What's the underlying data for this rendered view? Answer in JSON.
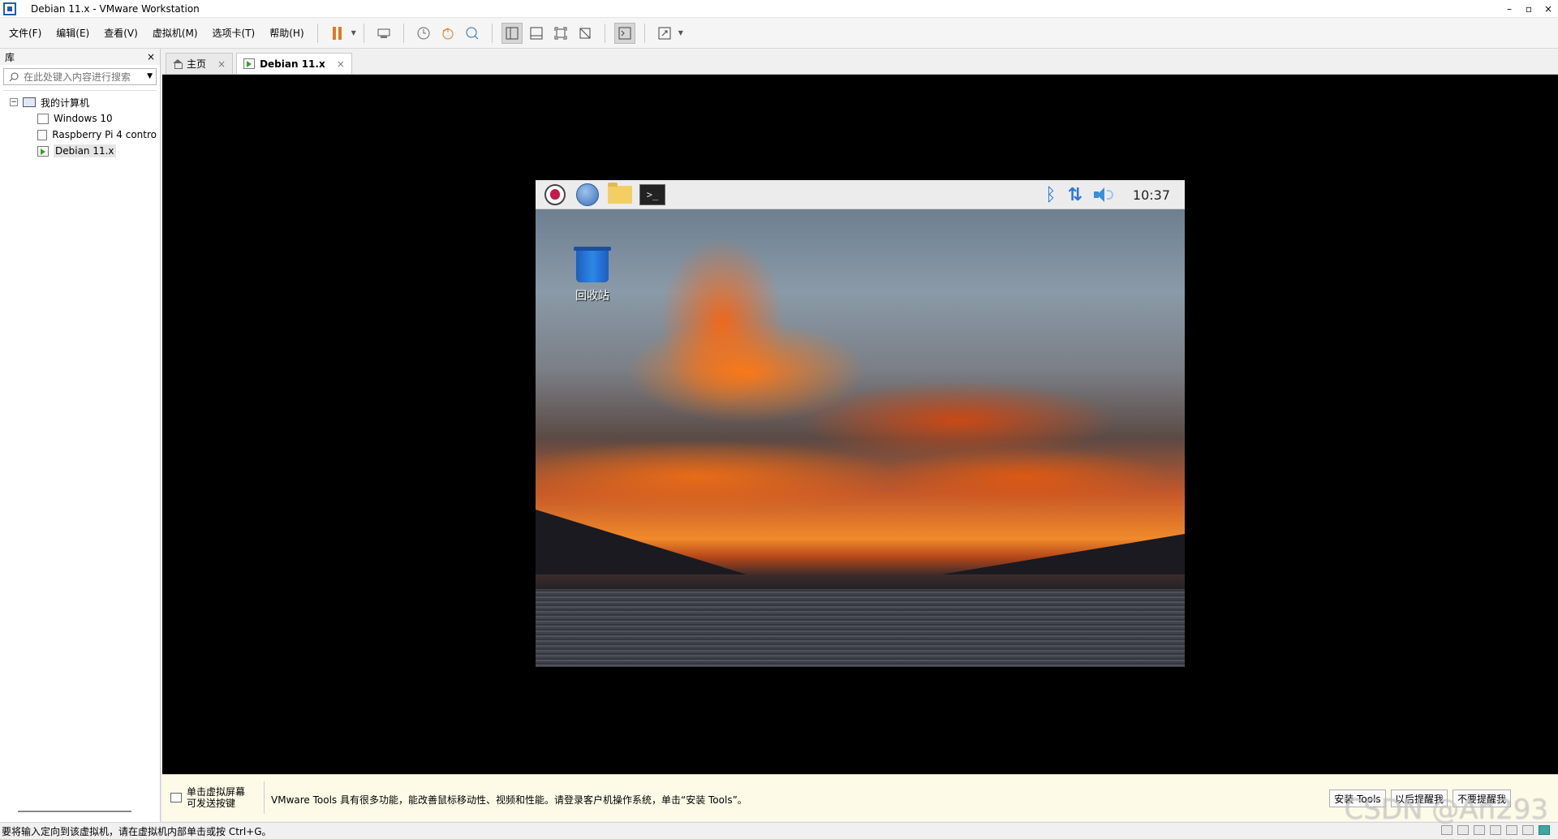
{
  "window": {
    "title": "Debian 11.x - VMware Workstation",
    "controls": [
      "–",
      "▫",
      "×"
    ]
  },
  "menu": [
    "文件(F)",
    "编辑(E)",
    "查看(V)",
    "虚拟机(M)",
    "选项卡(T)",
    "帮助(H)"
  ],
  "library": {
    "title": "库",
    "close": "×",
    "search_placeholder": "在此处键入内容进行搜索",
    "root": "我的计算机",
    "items": [
      "Windows 10",
      "Raspberry Pi 4 contro",
      "Debian 11.x"
    ]
  },
  "tabs": [
    {
      "label": "主页"
    },
    {
      "label": "Debian 11.x"
    }
  ],
  "guest": {
    "clock": "10:37",
    "trash_label": "回收站",
    "terminal_glyph": ">_"
  },
  "hint": {
    "left_line1": "单击虚拟屏幕",
    "left_line2": "可发送按键",
    "message": "VMware Tools 具有很多功能，能改善鼠标移动性、视频和性能。请登录客户机操作系统，单击“安装 Tools”。",
    "btn_install": "安装 Tools",
    "btn_later": "以后提醒我",
    "btn_never": "不要提醒我"
  },
  "status": {
    "text": "要将输入定向到该虚拟机，请在虚拟机内部单击或按 Ctrl+G。"
  },
  "watermark": "CSDN @An293",
  "colors": {
    "accent": "#1e5fa8",
    "pause": "#e07a1f",
    "hint_bg": "#fdfbe8"
  }
}
